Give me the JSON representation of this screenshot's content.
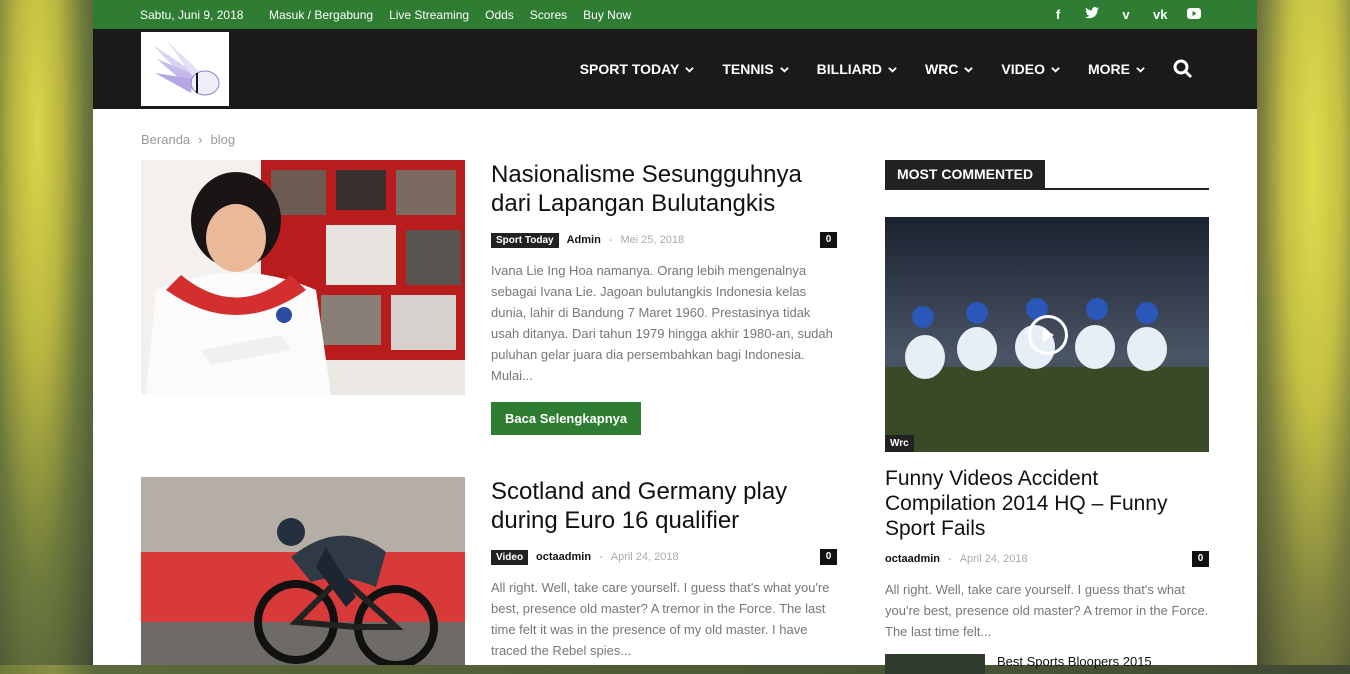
{
  "topbar": {
    "date": "Sabtu, Juni 9, 2018",
    "links": [
      "Masuk / Bergabung",
      "Live Streaming",
      "Odds",
      "Scores",
      "Buy Now"
    ]
  },
  "header": {
    "nav": [
      "SPORT TODAY",
      "TENNIS",
      "BILLIARD",
      "WRC",
      "VIDEO",
      "MORE"
    ]
  },
  "breadcrumb": {
    "home": "Beranda",
    "sep": "›",
    "current": "blog"
  },
  "posts": [
    {
      "title": "Nasionalisme Sesungguhnya dari Lapangan Bulutangkis",
      "category": "Sport Today",
      "author": "Admin",
      "date": "Mei 25, 2018",
      "comments": "0",
      "excerpt": "Ivana Lie Ing Hoa namanya. Orang lebih mengenalnya sebagai Ivana Lie. Jagoan bulutangkis Indonesia kelas dunia, lahir di Bandung 7 Maret 1960. Prestasinya tidak usah ditanya. Dari tahun 1979 hingga akhir 1980-an, sudah puluhan gelar juara dia persembahkan bagi Indonesia. Mulai...",
      "button": "Baca Selengkapnya"
    },
    {
      "title": "Scotland and Germany play during Euro 16 qualifier",
      "category": "Video",
      "author": "octaadmin",
      "date": "April 24, 2018",
      "comments": "0",
      "excerpt": "All right. Well, take care yourself. I guess that's what you're best, presence old master? A tremor in the Force. The last time felt it was in the presence of my old master. I have traced the Rebel spies..."
    }
  ],
  "sidebar": {
    "block_title": "MOST COMMENTED",
    "post": {
      "tag": "Wrc",
      "title": "Funny Videos Accident Compilation 2014 HQ – Funny Sport Fails",
      "author": "octaadmin",
      "date": "April 24, 2018",
      "comments": "0",
      "excerpt": "All right. Well, take care yourself. I guess that's what you're best, presence old master? A tremor in the Force. The last time felt..."
    },
    "next_title": "Best Sports Bloopers 2015"
  },
  "colors": {
    "accent": "#2e7d32",
    "dark": "#1a1a1a"
  }
}
